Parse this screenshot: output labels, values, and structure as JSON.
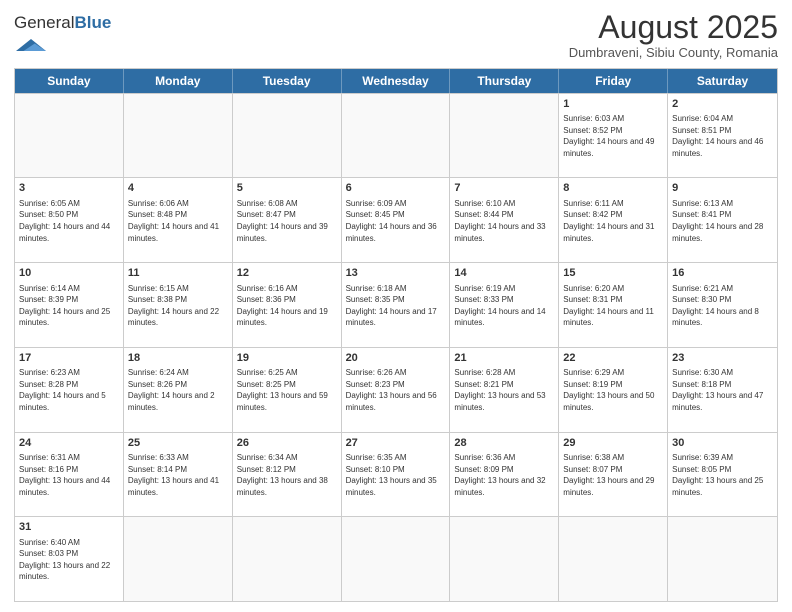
{
  "header": {
    "logo_general": "General",
    "logo_blue": "Blue",
    "month_title": "August 2025",
    "location": "Dumbraveni, Sibiu County, Romania"
  },
  "weekdays": [
    "Sunday",
    "Monday",
    "Tuesday",
    "Wednesday",
    "Thursday",
    "Friday",
    "Saturday"
  ],
  "rows": [
    {
      "cells": [
        {
          "day": "",
          "info": ""
        },
        {
          "day": "",
          "info": ""
        },
        {
          "day": "",
          "info": ""
        },
        {
          "day": "",
          "info": ""
        },
        {
          "day": "",
          "info": ""
        },
        {
          "day": "1",
          "info": "Sunrise: 6:03 AM\nSunset: 8:52 PM\nDaylight: 14 hours and 49 minutes."
        },
        {
          "day": "2",
          "info": "Sunrise: 6:04 AM\nSunset: 8:51 PM\nDaylight: 14 hours and 46 minutes."
        }
      ]
    },
    {
      "cells": [
        {
          "day": "3",
          "info": "Sunrise: 6:05 AM\nSunset: 8:50 PM\nDaylight: 14 hours and 44 minutes."
        },
        {
          "day": "4",
          "info": "Sunrise: 6:06 AM\nSunset: 8:48 PM\nDaylight: 14 hours and 41 minutes."
        },
        {
          "day": "5",
          "info": "Sunrise: 6:08 AM\nSunset: 8:47 PM\nDaylight: 14 hours and 39 minutes."
        },
        {
          "day": "6",
          "info": "Sunrise: 6:09 AM\nSunset: 8:45 PM\nDaylight: 14 hours and 36 minutes."
        },
        {
          "day": "7",
          "info": "Sunrise: 6:10 AM\nSunset: 8:44 PM\nDaylight: 14 hours and 33 minutes."
        },
        {
          "day": "8",
          "info": "Sunrise: 6:11 AM\nSunset: 8:42 PM\nDaylight: 14 hours and 31 minutes."
        },
        {
          "day": "9",
          "info": "Sunrise: 6:13 AM\nSunset: 8:41 PM\nDaylight: 14 hours and 28 minutes."
        }
      ]
    },
    {
      "cells": [
        {
          "day": "10",
          "info": "Sunrise: 6:14 AM\nSunset: 8:39 PM\nDaylight: 14 hours and 25 minutes."
        },
        {
          "day": "11",
          "info": "Sunrise: 6:15 AM\nSunset: 8:38 PM\nDaylight: 14 hours and 22 minutes."
        },
        {
          "day": "12",
          "info": "Sunrise: 6:16 AM\nSunset: 8:36 PM\nDaylight: 14 hours and 19 minutes."
        },
        {
          "day": "13",
          "info": "Sunrise: 6:18 AM\nSunset: 8:35 PM\nDaylight: 14 hours and 17 minutes."
        },
        {
          "day": "14",
          "info": "Sunrise: 6:19 AM\nSunset: 8:33 PM\nDaylight: 14 hours and 14 minutes."
        },
        {
          "day": "15",
          "info": "Sunrise: 6:20 AM\nSunset: 8:31 PM\nDaylight: 14 hours and 11 minutes."
        },
        {
          "day": "16",
          "info": "Sunrise: 6:21 AM\nSunset: 8:30 PM\nDaylight: 14 hours and 8 minutes."
        }
      ]
    },
    {
      "cells": [
        {
          "day": "17",
          "info": "Sunrise: 6:23 AM\nSunset: 8:28 PM\nDaylight: 14 hours and 5 minutes."
        },
        {
          "day": "18",
          "info": "Sunrise: 6:24 AM\nSunset: 8:26 PM\nDaylight: 14 hours and 2 minutes."
        },
        {
          "day": "19",
          "info": "Sunrise: 6:25 AM\nSunset: 8:25 PM\nDaylight: 13 hours and 59 minutes."
        },
        {
          "day": "20",
          "info": "Sunrise: 6:26 AM\nSunset: 8:23 PM\nDaylight: 13 hours and 56 minutes."
        },
        {
          "day": "21",
          "info": "Sunrise: 6:28 AM\nSunset: 8:21 PM\nDaylight: 13 hours and 53 minutes."
        },
        {
          "day": "22",
          "info": "Sunrise: 6:29 AM\nSunset: 8:19 PM\nDaylight: 13 hours and 50 minutes."
        },
        {
          "day": "23",
          "info": "Sunrise: 6:30 AM\nSunset: 8:18 PM\nDaylight: 13 hours and 47 minutes."
        }
      ]
    },
    {
      "cells": [
        {
          "day": "24",
          "info": "Sunrise: 6:31 AM\nSunset: 8:16 PM\nDaylight: 13 hours and 44 minutes."
        },
        {
          "day": "25",
          "info": "Sunrise: 6:33 AM\nSunset: 8:14 PM\nDaylight: 13 hours and 41 minutes."
        },
        {
          "day": "26",
          "info": "Sunrise: 6:34 AM\nSunset: 8:12 PM\nDaylight: 13 hours and 38 minutes."
        },
        {
          "day": "27",
          "info": "Sunrise: 6:35 AM\nSunset: 8:10 PM\nDaylight: 13 hours and 35 minutes."
        },
        {
          "day": "28",
          "info": "Sunrise: 6:36 AM\nSunset: 8:09 PM\nDaylight: 13 hours and 32 minutes."
        },
        {
          "day": "29",
          "info": "Sunrise: 6:38 AM\nSunset: 8:07 PM\nDaylight: 13 hours and 29 minutes."
        },
        {
          "day": "30",
          "info": "Sunrise: 6:39 AM\nSunset: 8:05 PM\nDaylight: 13 hours and 25 minutes."
        }
      ]
    },
    {
      "cells": [
        {
          "day": "31",
          "info": "Sunrise: 6:40 AM\nSunset: 8:03 PM\nDaylight: 13 hours and 22 minutes."
        },
        {
          "day": "",
          "info": ""
        },
        {
          "day": "",
          "info": ""
        },
        {
          "day": "",
          "info": ""
        },
        {
          "day": "",
          "info": ""
        },
        {
          "day": "",
          "info": ""
        },
        {
          "day": "",
          "info": ""
        }
      ]
    }
  ]
}
